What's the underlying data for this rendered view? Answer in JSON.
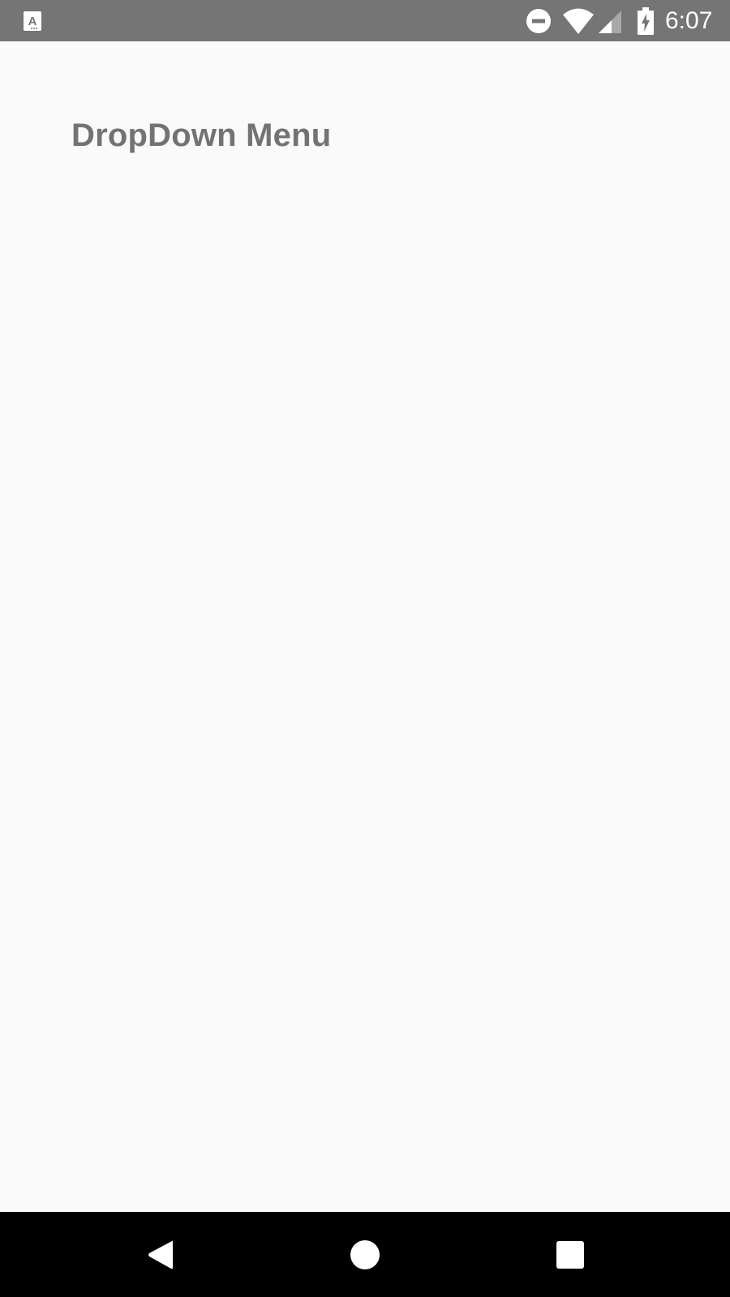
{
  "status_bar": {
    "time": "6:07",
    "left_icon": "text-a-notification-icon",
    "icons": [
      "do-not-disturb-icon",
      "wifi-icon",
      "cellular-signal-icon",
      "battery-charging-icon"
    ],
    "background_color": "#757575"
  },
  "main": {
    "title": "DropDown Menu",
    "title_color": "#737373",
    "background_color": "#fafafa"
  },
  "nav_bar": {
    "buttons": [
      "back-icon",
      "home-icon",
      "recents-icon"
    ],
    "background_color": "#000000"
  }
}
